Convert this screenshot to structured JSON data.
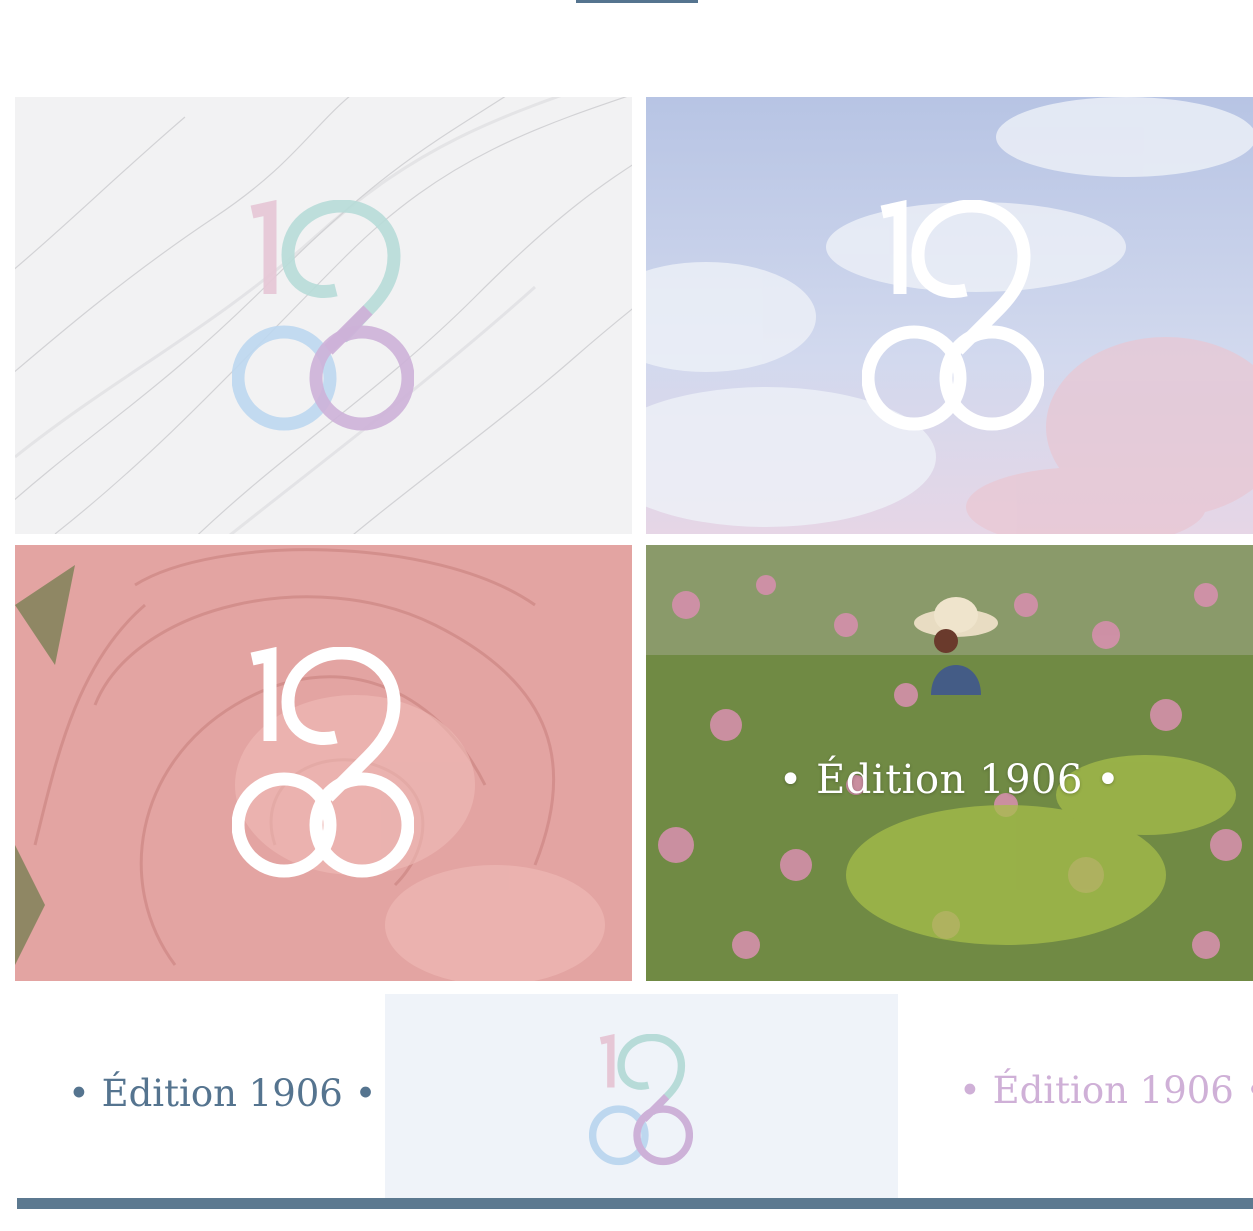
{
  "brand": {
    "edition_label": "Édition 1906",
    "colors": {
      "navy": "#55748f",
      "rose": "#e6c7d6",
      "teal": "#b7dbd8",
      "blue": "#bdd7ef",
      "lilac": "#cdb1d8",
      "panel": "#eff3f9",
      "white": "#ffffff"
    }
  },
  "tiles": [
    {
      "background": "marble",
      "logo_style": "pastel"
    },
    {
      "background": "sky-clouds",
      "logo_style": "white"
    },
    {
      "background": "pink-rose",
      "logo_style": "white"
    },
    {
      "background": "rose-field",
      "label": "• Édition 1906 •"
    }
  ],
  "footer": {
    "left_label": "• Édition 1906 •",
    "right_label": "• Édition 1906 •",
    "center_logo_style": "pastel"
  }
}
